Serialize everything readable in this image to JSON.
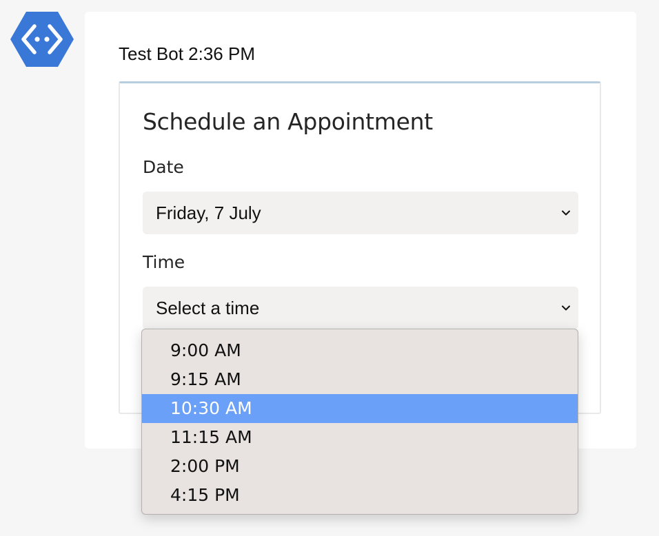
{
  "colors": {
    "accent": "#3a78d8",
    "highlight": "#6aa0f7",
    "card_border_top": "#b7cde0",
    "select_bg": "#f2f1f0",
    "dropdown_bg": "#e8e3e0"
  },
  "bot": {
    "avatar_icon": "bot-framework-logo-icon",
    "name": "Test Bot",
    "time": "2:36 PM",
    "sender_line": "Test Bot 2:36 PM"
  },
  "card": {
    "title": "Schedule an Appointment",
    "date": {
      "label": "Date",
      "value": "Friday, 7 July",
      "icon": "chevron-down-icon"
    },
    "time": {
      "label": "Time",
      "value": "Select a time",
      "icon": "chevron-down-icon"
    }
  },
  "dropdown": {
    "options": [
      "9:00 AM",
      "9:15 AM",
      "10:30 AM",
      "11:15 AM",
      "2:00 PM",
      "4:15 PM"
    ],
    "highlighted": "10:30 AM"
  }
}
